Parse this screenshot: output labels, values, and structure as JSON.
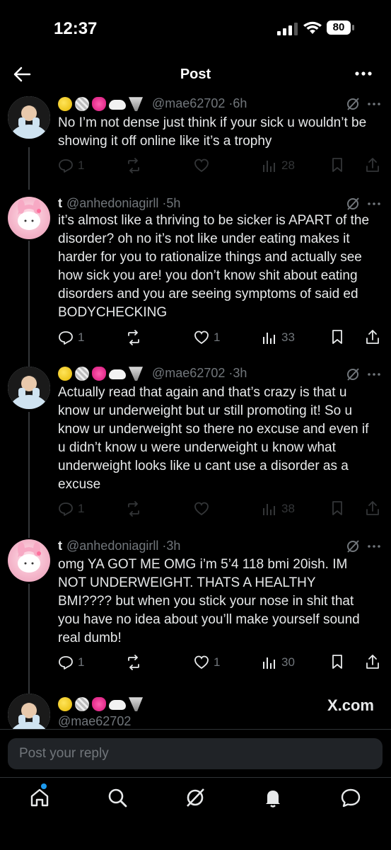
{
  "status": {
    "time": "12:37",
    "battery": "80"
  },
  "header": {
    "title": "Post"
  },
  "tweets": [
    {
      "handle": "@mae62702",
      "time": "6h",
      "text": "No I’m not dense just think if your sick u wouldn’t be showing it off online like it’s a trophy",
      "replies": "1",
      "likes": "",
      "views": "28"
    },
    {
      "name": "t",
      "handle": "@anhedoniagirll",
      "time": "5h",
      "text": "it’s almost like a thriving to be sicker is APART of the disorder? oh no it’s not like under eating makes it harder for you to rationalize things and actually see how sick you are! you don’t know shit about eating disorders and you are seeing symptoms of said ed BODYCHECKING",
      "replies": "1",
      "likes": "1",
      "views": "33"
    },
    {
      "handle": "@mae62702",
      "time": "3h",
      "text": "Actually read that again and that’s crazy is that u know ur underweight but ur still promoting it! So u know ur underweight so there no excuse and even if u didn’t know u were underweight u know what underweight looks like u cant use a disorder as a excuse",
      "replies": "1",
      "likes": "",
      "views": "38"
    },
    {
      "name": "t",
      "handle": "@anhedoniagirll",
      "time": "3h",
      "text": "omg YA GOT ME OMG i’m 5’4 118 bmi 20ish. IM NOT UNDERWEIGHT. THATS A HEALTHY BMI???? but when you stick your nose in shit that you have no idea about you’ll make yourself sound real dumb!",
      "replies": "1",
      "likes": "1",
      "views": "30"
    },
    {
      "handle": "@mae62702"
    }
  ],
  "watermark": "X.com",
  "reply": {
    "placeholder": "Post your reply"
  },
  "icons": {
    "back": "back-arrow-icon",
    "more": "more-icon",
    "home": "home-icon",
    "search": "search-icon",
    "grok": "grok-icon",
    "notifications": "bell-icon",
    "messages": "message-icon"
  },
  "colors": {
    "background": "#000000",
    "text": "#e7e9ea",
    "muted": "#71767b",
    "accent": "#1d9bf0"
  }
}
